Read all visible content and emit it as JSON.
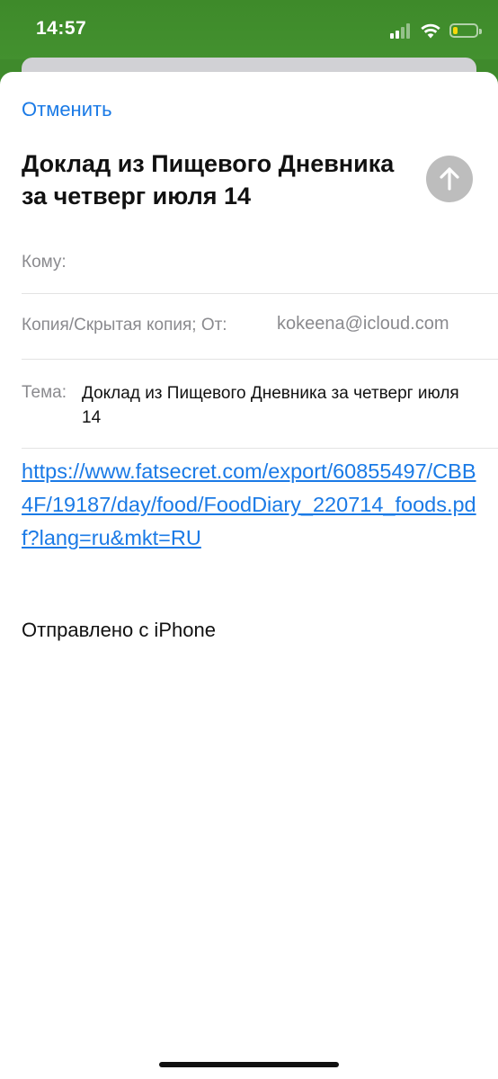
{
  "status_bar": {
    "time": "14:57",
    "icons": [
      "signal-icon",
      "wifi-icon",
      "battery-icon"
    ],
    "battery_level": 0.2,
    "battery_color": "#f5d90a"
  },
  "compose": {
    "cancel_label": "Отменить",
    "title": "Доклад из Пищевого Дневника за четверг июля 14",
    "to_label": "Кому:",
    "cc_label": "Копия/Скрытая копия; От:",
    "from_value": "kokeena@icloud.com",
    "subject_label": "Тема:",
    "subject_value": "Доклад из Пищевого Дневника за четверг июля 14",
    "body_link": "https://www.fatsecret.com/export/60855497/CBB4F/19187/day/food/FoodDiary_220714_foods.pdf?lang=ru&mkt=RU",
    "signature": "Отправлено с iPhone",
    "send_icon": "arrow-up-icon"
  },
  "colors": {
    "accent": "#1a7ae6",
    "header_green": "#3f8a2c",
    "send_button_disabled": "#bdbdbd"
  }
}
